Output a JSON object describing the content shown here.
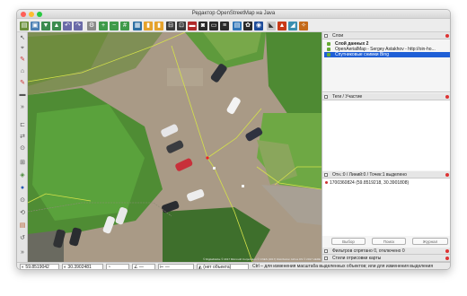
{
  "window": {
    "title": "Редактор OpenStreetMap на Java",
    "lights": [
      "#ff5f57",
      "#febc2e",
      "#28c840"
    ]
  },
  "toolbar": {
    "icons": [
      "open-file-icon",
      "save-icon",
      "download-icon",
      "upload-icon",
      "undo-icon",
      "redo-icon",
      "preferences-icon",
      "presets-icon",
      "tag-icon",
      "relation-icon",
      "help-icon"
    ]
  },
  "left_tools": [
    "select-icon",
    "lasso-icon",
    "draw-icon",
    "zoom-icon",
    "delete-icon",
    "split-icon",
    "combine-icon",
    "reverse-icon",
    "align-icon",
    "undo-small-icon"
  ],
  "panels": {
    "layers": {
      "title": "Слои",
      "items": [
        "Слой данных 2",
        "OpenAerialMap - Sergey Astakhov - http://oin-ho...",
        "Спутниковые снимки Bing"
      ]
    },
    "tags": {
      "title": "Теги / Участие"
    },
    "selection": {
      "title": "Отн.:0 / Линий:0 / Точек:1 выделено",
      "item": "1700360824 (59.8519218, 30.3901808)",
      "buttons": [
        "Выбор",
        "Поиск",
        "Журнал"
      ]
    },
    "filters": {
      "title": "Фильтров спрятано 0, отключено 0"
    },
    "styles": {
      "title": "Стили отрисовки карты"
    }
  },
  "map": {
    "attribution": "© DigitalGlobe © 2017 Microsoft Corporation © CNES (2017) Distribution Airbus DS © 2017 HERE"
  },
  "status": {
    "lat": "59.8519042",
    "lon": "30.3902481",
    "heading": "—",
    "distance": "—",
    "state": "(нет объекта)",
    "hint": "Ctrl – для изменения масштаба выделенных объектов; или для изменения выделения"
  }
}
